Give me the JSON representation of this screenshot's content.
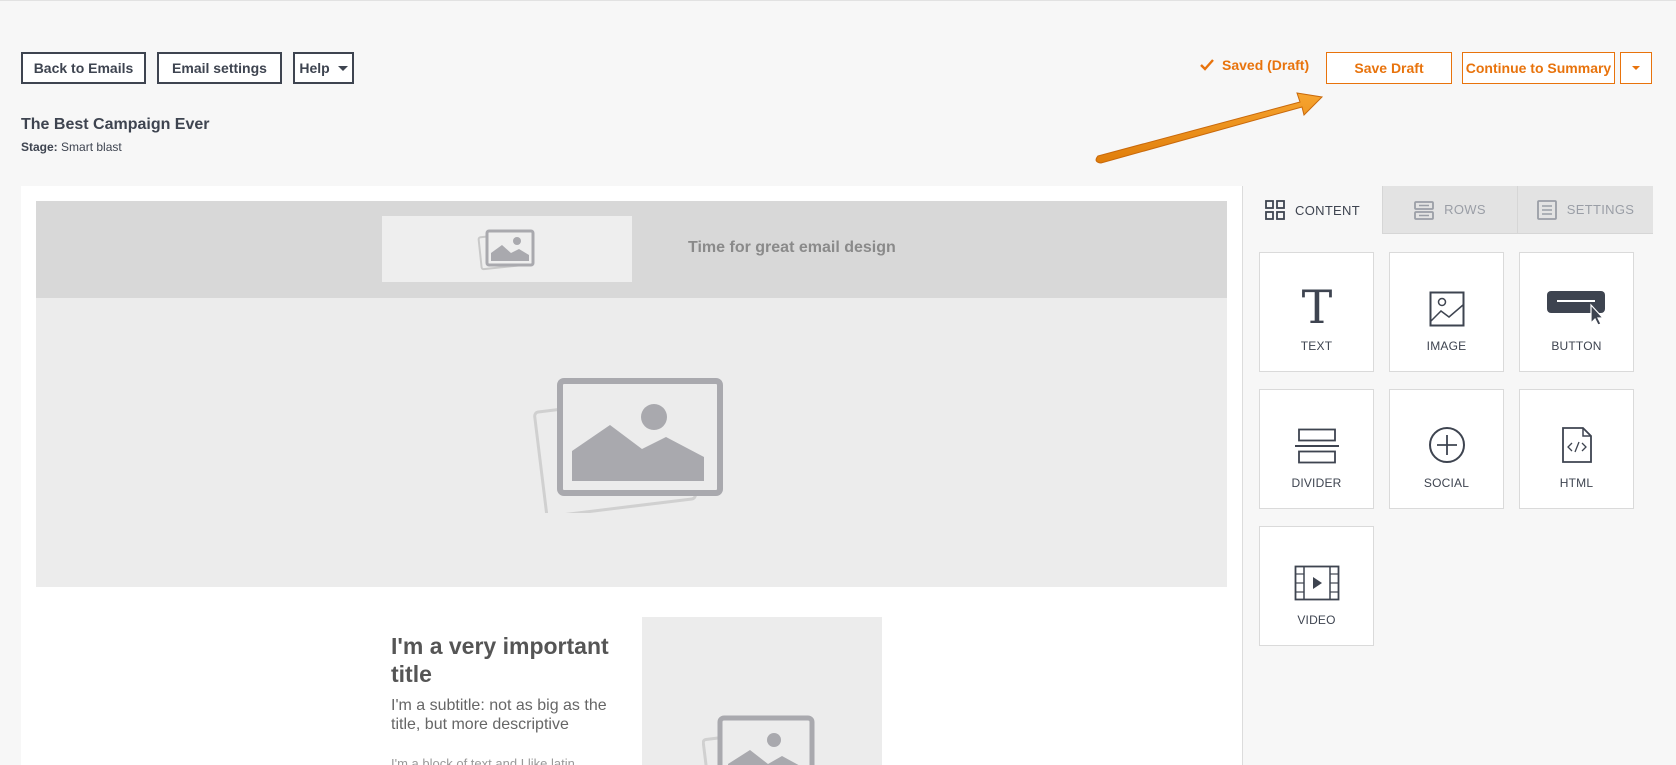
{
  "toolbar": {
    "back_label": "Back to Emails",
    "settings_label": "Email settings",
    "help_label": "Help",
    "saved_label": "Saved (Draft)",
    "save_draft_label": "Save Draft",
    "continue_label": "Continue to Summary"
  },
  "campaign": {
    "title": "The Best Campaign Ever",
    "stage_label": "Stage:",
    "stage_value": "Smart blast"
  },
  "email": {
    "header_text": "Time for great email design",
    "title": "I'm a very important title",
    "subtitle": "I'm a subtitle: not as big as the title, but more descriptive",
    "body": "I'm a block of text and I like latin."
  },
  "panel": {
    "tabs": [
      {
        "label": "CONTENT",
        "icon": "grid-icon",
        "active": true
      },
      {
        "label": "ROWS",
        "icon": "rows-icon",
        "active": false
      },
      {
        "label": "SETTINGS",
        "icon": "settings-list-icon",
        "active": false
      }
    ],
    "tiles": [
      {
        "label": "TEXT",
        "icon": "text-icon"
      },
      {
        "label": "IMAGE",
        "icon": "image-icon"
      },
      {
        "label": "BUTTON",
        "icon": "button-icon"
      },
      {
        "label": "DIVIDER",
        "icon": "divider-icon"
      },
      {
        "label": "SOCIAL",
        "icon": "social-plus-icon"
      },
      {
        "label": "HTML",
        "icon": "html-code-icon"
      },
      {
        "label": "VIDEO",
        "icon": "video-icon"
      }
    ]
  },
  "colors": {
    "accent": "#e8730c",
    "text": "#3e4450",
    "arrow": "#f0900f"
  }
}
